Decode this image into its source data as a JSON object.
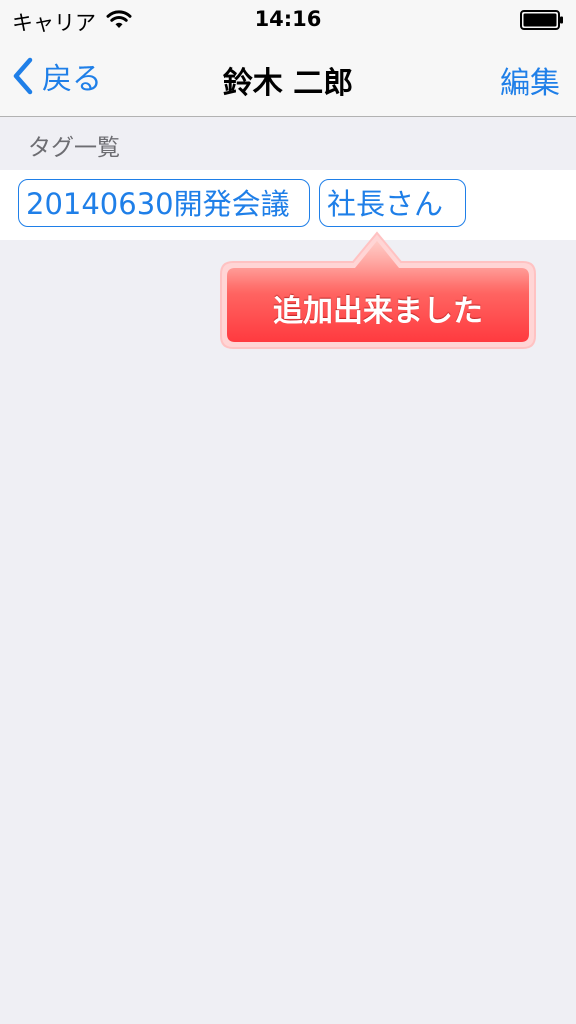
{
  "status_bar": {
    "carrier": "キャリア",
    "time": "14:16"
  },
  "nav": {
    "back_label": "戻る",
    "title": "鈴木 二郎",
    "edit_label": "編集"
  },
  "section": {
    "header": "タグ一覧"
  },
  "tags": [
    {
      "label": "20140630開発会議"
    },
    {
      "label": "社長さん"
    }
  ],
  "toast": {
    "message": "追加出来ました"
  },
  "colors": {
    "accent": "#1f7fe8",
    "toast_red": "#ff4848",
    "background": "#efeff4"
  },
  "icons": {
    "wifi": "wifi-icon",
    "battery": "battery-icon",
    "back": "chevron-left-icon"
  }
}
